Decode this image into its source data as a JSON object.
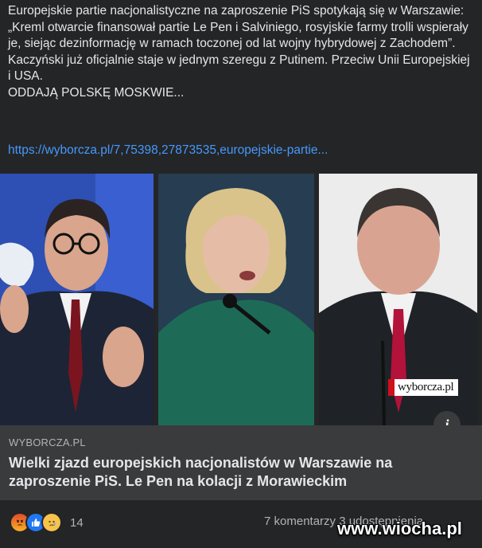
{
  "post": {
    "lines": [
      "Europejskie partie nacjonalistyczne na zaproszenie PiS spotykają się w Warszawie: „Kreml otwarcie finansował partie Le Pen i Salviniego, rosyjskie farmy trolli wspierały je, siejąc dezinformację w ramach toczonej od lat wojny hybrydowej z Zachodem”.",
      "Kaczyński już oficjalnie staje w jednym szeregu z Putinem. Przeciw Unii Europejskiej i  USA.",
      "ODDAJĄ POLSKĘ MOSKWIE..."
    ],
    "link_text": "https://wyborcza.pl/7,75398,27873535,europejskie-partie..."
  },
  "image": {
    "watermark": "wyborcza.pl",
    "info_icon": "i"
  },
  "link_card": {
    "domain": "WYBORCZA.PL",
    "title": "Wielki zjazd europejskich nacjonalistów w Warszawie na zaproszenie PiS. Le Pen na kolacji z Morawieckim"
  },
  "footer": {
    "reaction_icons": [
      "angry-icon",
      "like-icon",
      "sad-icon"
    ],
    "reaction_count": "14",
    "stats": "7 komentarzy  3 udostępnienia",
    "site_watermark": "www.wiocha.pl"
  },
  "colors": {
    "background": "#242526",
    "card": "#3a3b3c",
    "link": "#4599ff",
    "text": "#e4e6eb",
    "secondary_text": "#b0b3b8"
  }
}
